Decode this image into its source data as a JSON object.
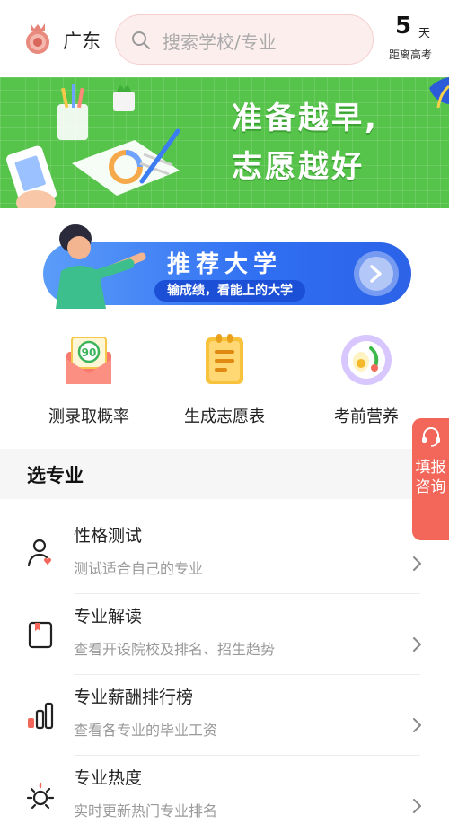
{
  "header": {
    "location": "广东",
    "search_placeholder": "搜索学校/专业",
    "countdown_number": "5",
    "countdown_unit": "天",
    "countdown_label": "距离高考"
  },
  "banner": {
    "line1": "准备越早,",
    "line2": "志愿越好",
    "dots": 3,
    "active_dot": 1
  },
  "recommend": {
    "title": "推荐大学",
    "subtitle": "输成绩，看能上的大学"
  },
  "tools": [
    {
      "label": "测录取概率",
      "icon": "envelope-score-icon",
      "badge": "90"
    },
    {
      "label": "生成志愿表",
      "icon": "form-list-icon"
    },
    {
      "label": "考前营养",
      "icon": "nutrition-plate-icon"
    }
  ],
  "side_consult": {
    "text": "填报咨询"
  },
  "section": {
    "title": "选专业"
  },
  "list": [
    {
      "title": "性格测试",
      "desc": "测试适合自己的专业",
      "icon": "person-heart-icon"
    },
    {
      "title": "专业解读",
      "desc": "查看开设院校及排名、招生趋势",
      "icon": "bookmark-book-icon"
    },
    {
      "title": "专业薪酬排行榜",
      "desc": "查看各专业的毕业工资",
      "icon": "bar-chart-icon"
    },
    {
      "title": "专业热度",
      "desc": "实时更新热门专业排名",
      "icon": "sun-icon"
    }
  ],
  "colors": {
    "accent_red": "#f2675a",
    "banner_green": "#56c44a",
    "recommend_blue": "#2f6ef2"
  }
}
